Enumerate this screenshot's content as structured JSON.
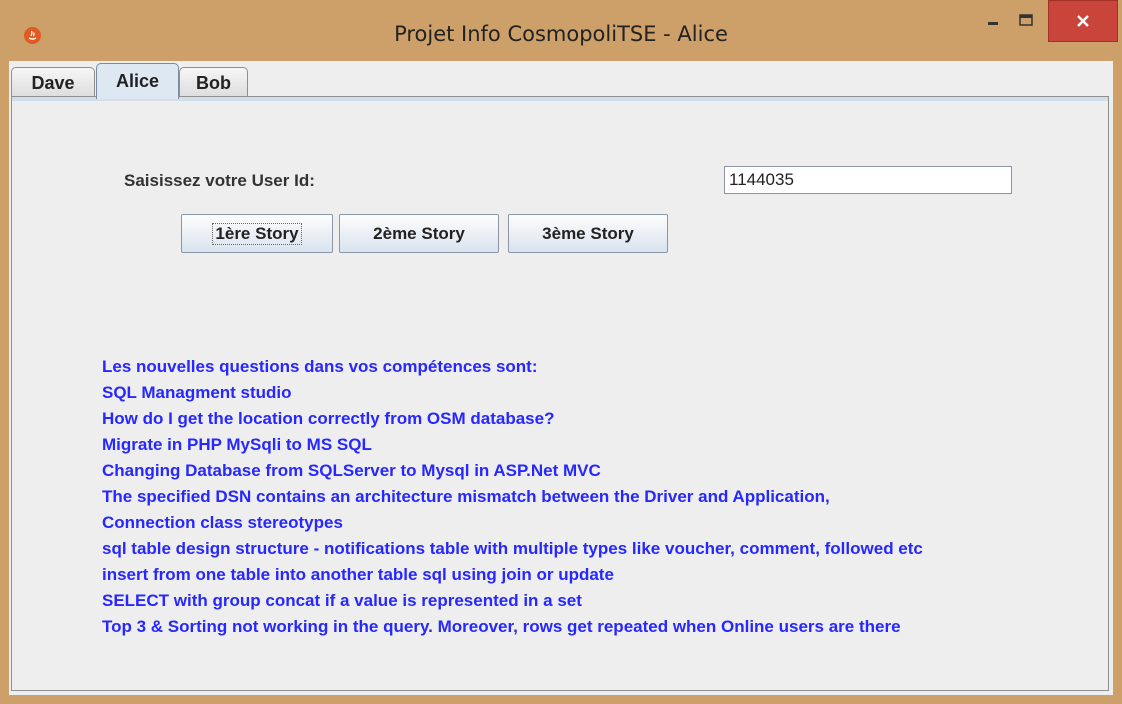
{
  "window": {
    "title": "Projet Info CosmopoliTSE - Alice",
    "icon": "java-app-icon",
    "controls": {
      "minimize": "minimize-icon",
      "maximize": "maximize-icon",
      "close": "close-icon"
    },
    "colors": {
      "frame": "#cda06a",
      "close_button": "#c9453c",
      "question_text": "#2727ff"
    }
  },
  "tabs": [
    {
      "label": "Dave",
      "active": false
    },
    {
      "label": "Alice",
      "active": true
    },
    {
      "label": "Bob",
      "active": false
    }
  ],
  "form": {
    "userid_label": "Saisissez votre User Id:",
    "userid_value": "1144035",
    "buttons": [
      "1ère Story",
      "2ème Story",
      "3ème Story"
    ]
  },
  "questions": {
    "heading": "Les nouvelles questions dans vos compétences sont:",
    "items": [
      " SQL Managment studio",
      "How do I get the location correctly from OSM database?",
      "Migrate in PHP MySqli to MS SQL",
      "Changing Database from SQLServer to Mysql in ASP.Net MVC",
      "The specified DSN contains an architecture mismatch between the Driver and Application,",
      "Connection class stereotypes",
      "sql table design structure - notifications table with multiple types like voucher, comment, followed etc",
      "insert from one table into another table sql using join or update",
      " SELECT with group concat if a value is represented in a set",
      "Top 3 & Sorting not working in the query. Moreover, rows get repeated when Online users are there"
    ]
  }
}
